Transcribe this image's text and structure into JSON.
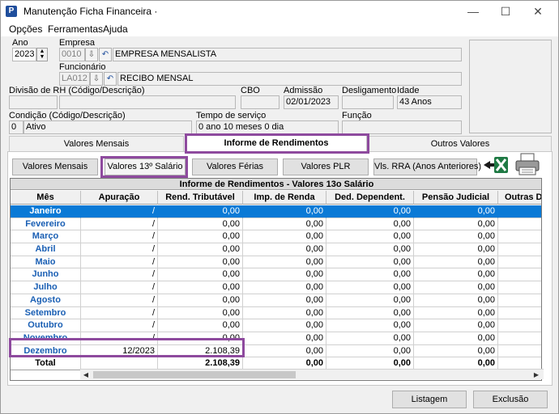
{
  "window": {
    "title": "Manutenção Ficha Financeira ·",
    "minimize": "—",
    "maximize": "☐",
    "close": "✕"
  },
  "menu": [
    "Opções",
    "Ferramentas",
    "Ajuda"
  ],
  "form": {
    "ano_label": "Ano",
    "ano_value": "2023",
    "empresa_label": "Empresa",
    "empresa_code": "0010",
    "empresa_name": "EMPRESA MENSALISTA",
    "funcionario_label": "Funcionário",
    "funcionario_code": "LA012",
    "funcionario_name": "RECIBO MENSAL",
    "divisao_label": "Divisão de RH (Código/Descrição)",
    "cbo_label": "CBO",
    "admissao_label": "Admissão",
    "admissao_value": "02/01/2023",
    "desligamento_label": "Desligamento",
    "idade_label": "Idade",
    "idade_value": "43 Anos",
    "condicao_label": "Condição (Código/Descrição)",
    "condicao_code": "0",
    "condicao_desc": "Ativo",
    "tempo_label": "Tempo de serviço",
    "tempo_value": "0 ano 10 meses 0 dia",
    "funcao_label": "Função"
  },
  "tabs": [
    "Valores Mensais",
    "Informe de Rendimentos",
    "Outros Valores"
  ],
  "subbuttons": [
    "Valores Mensais",
    "Valores 13º Salário",
    "Valores Férias",
    "Valores PLR",
    "Vls. RRA (Anos Anteriores)"
  ],
  "grid": {
    "title": "Informe de Rendimentos - Valores 13o Salário",
    "columns": [
      "Mês",
      "Apuração",
      "Rend. Tributável",
      "Imp. de Renda",
      "Ded. Dependent.",
      "Pensão Judicial",
      "Outras De"
    ],
    "rows": [
      [
        "Janeiro",
        "/",
        "0,00",
        "0,00",
        "0,00",
        "0,00"
      ],
      [
        "Fevereiro",
        "/",
        "0,00",
        "0,00",
        "0,00",
        "0,00"
      ],
      [
        "Março",
        "/",
        "0,00",
        "0,00",
        "0,00",
        "0,00"
      ],
      [
        "Abril",
        "/",
        "0,00",
        "0,00",
        "0,00",
        "0,00"
      ],
      [
        "Maio",
        "/",
        "0,00",
        "0,00",
        "0,00",
        "0,00"
      ],
      [
        "Junho",
        "/",
        "0,00",
        "0,00",
        "0,00",
        "0,00"
      ],
      [
        "Julho",
        "/",
        "0,00",
        "0,00",
        "0,00",
        "0,00"
      ],
      [
        "Agosto",
        "/",
        "0,00",
        "0,00",
        "0,00",
        "0,00"
      ],
      [
        "Setembro",
        "/",
        "0,00",
        "0,00",
        "0,00",
        "0,00"
      ],
      [
        "Outubro",
        "/",
        "0,00",
        "0,00",
        "0,00",
        "0,00"
      ],
      [
        "Novembro",
        "/",
        "0,00",
        "0,00",
        "0,00",
        "0,00"
      ],
      [
        "Dezembro",
        "12/2023",
        "2.108,39",
        "0,00",
        "0,00",
        "0,00"
      ]
    ],
    "total": [
      "Total",
      "",
      "2.108,39",
      "0,00",
      "0,00",
      "0,00"
    ]
  },
  "footer": [
    "Listagem",
    "Exclusão"
  ],
  "colors": {
    "highlight": "#8e4a9e",
    "selection": "#0a7ad6",
    "month_text": "#1a5fb4"
  }
}
